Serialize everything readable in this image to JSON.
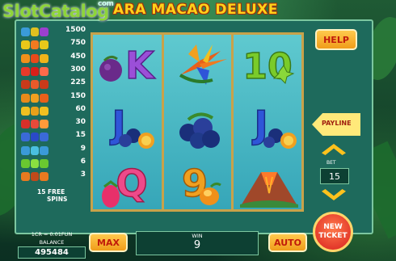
{
  "watermark": {
    "brand": "SlotCatalog",
    "suffix": "com"
  },
  "game_title": "ARA MACAO DELUXE",
  "paytable": {
    "rows": [
      {
        "value": "1500",
        "colors": [
          "#3a9bd8",
          "#e0c020",
          "#9b3fcf"
        ]
      },
      {
        "value": "750",
        "colors": [
          "#e8c81a",
          "#f07a20",
          "#e8c81a"
        ]
      },
      {
        "value": "450",
        "colors": [
          "#f0901a",
          "#e84a1a",
          "#f0b41a"
        ]
      },
      {
        "value": "300",
        "colors": [
          "#e83a2a",
          "#d8201a",
          "#ff6a4a"
        ]
      },
      {
        "value": "225",
        "colors": [
          "#c93a1a",
          "#e85a2a",
          "#c93a1a"
        ]
      },
      {
        "value": "150",
        "colors": [
          "#e88a1a",
          "#f0a020",
          "#e8601a"
        ]
      },
      {
        "value": "60",
        "colors": [
          "#f0c020",
          "#e8a01a",
          "#f0c020"
        ]
      },
      {
        "value": "30",
        "colors": [
          "#d8302a",
          "#e84a3a",
          "#ff9a3a"
        ]
      },
      {
        "value": "15",
        "colors": [
          "#3a6ad8",
          "#2a4ac8",
          "#3a6ad8"
        ]
      },
      {
        "value": "9",
        "colors": [
          "#3a9ad8",
          "#4ac0e0",
          "#3a9ad8"
        ]
      },
      {
        "value": "6",
        "colors": [
          "#6ac830",
          "#8ae040",
          "#6ac830"
        ]
      },
      {
        "value": "3",
        "colors": [
          "#e87a20",
          "#c04a1a",
          "#e87a20"
        ]
      }
    ],
    "free_spins_value": "15 FREE",
    "free_spins_label": "SPINS"
  },
  "reels": {
    "grid": [
      [
        "K",
        "bird-of-paradise",
        "10"
      ],
      [
        "J",
        "blueberries",
        "J"
      ],
      [
        "Q",
        "9",
        "volcano"
      ]
    ],
    "colors": {
      "K": "#9b4fd8",
      "10": "#7acb2a",
      "J": "#2f55d8",
      "Q": "#ee4a8a",
      "9": "#f0a020"
    }
  },
  "sidebar": {
    "help_label": "HELP",
    "payline_label": "PAYLINE",
    "bet_label": "BET",
    "bet_value": "15"
  },
  "bottom": {
    "line1": "1CR = 0.01FUN",
    "balance_label": "BALANCE",
    "balance_value": "495484",
    "max_label": "MAX",
    "win_label": "WIN",
    "win_value": "9",
    "auto_label": "AUTO",
    "new_ticket_label": "NEW\nTICKET"
  }
}
